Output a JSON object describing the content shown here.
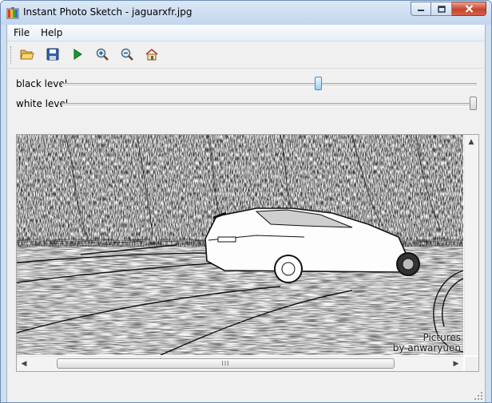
{
  "window": {
    "title": "Instant Photo Sketch - jaguarxfr.jpg"
  },
  "menu": {
    "file": "File",
    "help": "Help"
  },
  "toolbar": {
    "buttons": [
      "open-folder-icon",
      "save-icon",
      "play-icon",
      "zoom-in-icon",
      "zoom-out-icon",
      "home-icon"
    ]
  },
  "sliders": {
    "black": {
      "label": "black level",
      "value": 0.62
    },
    "white": {
      "label": "white level",
      "value": 1.0
    }
  },
  "image": {
    "watermark_line1": "Pictures",
    "watermark_line2": "by anwaryuen"
  },
  "scrollbar": {
    "grip": "III"
  },
  "colors": {
    "title_bar": "#c2d6ee",
    "close_button": "#c7432e",
    "slider_thumb": "#9cd1f4"
  }
}
